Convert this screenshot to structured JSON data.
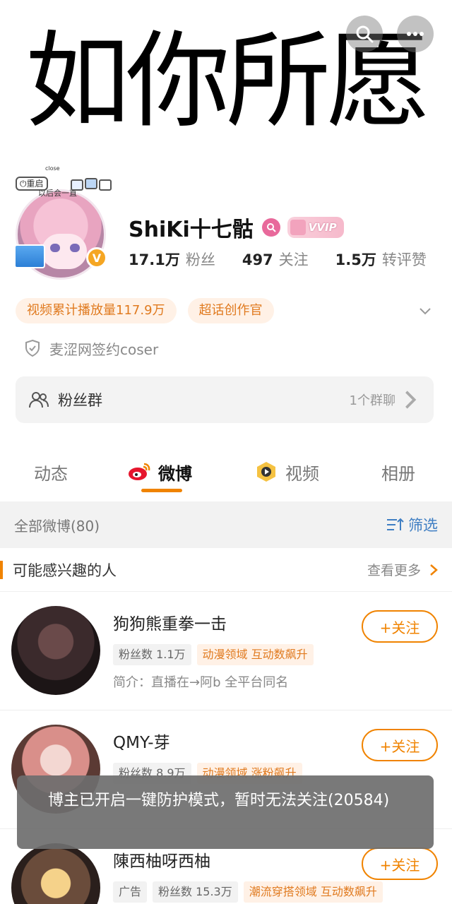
{
  "banner": {
    "text": "如你所愿",
    "back_icon": "back-arrow-icon",
    "search_icon": "search-icon",
    "more_icon": "more-icon"
  },
  "profile": {
    "avatar_labels": {
      "restart": "⏻重启",
      "close": "close",
      "later": "以后会一直"
    },
    "verified_badge": "V",
    "nickname": "ShiKi十七骷",
    "vvip_label": "VVIP",
    "stats": [
      {
        "num": "17.1万",
        "label": "粉丝"
      },
      {
        "num": "497",
        "label": "关注"
      },
      {
        "num": "1.5万",
        "label": "转评赞"
      }
    ],
    "tags": [
      "视频累计播放量117.9万",
      "超话创作官"
    ],
    "signed": "麦涩网签约coser",
    "fans_group": {
      "title": "粉丝群",
      "count": "1个群聊"
    }
  },
  "tabs": [
    {
      "label": "动态"
    },
    {
      "label": "微博"
    },
    {
      "label": "视频"
    },
    {
      "label": "相册"
    }
  ],
  "filter_bar": {
    "title": "全部微博(80)",
    "button": "筛选"
  },
  "interest": {
    "title": "可能感兴趣的人",
    "more": "查看更多",
    "people": [
      {
        "name": "狗狗熊重拳一击",
        "tags": [
          "粉丝数 1.1万",
          "动漫领域 互动数飙升"
        ],
        "intro": "简介：直播在→阿b 全平台同名",
        "follow": "+关注"
      },
      {
        "name": "QMY-芽",
        "tags": [
          "粉丝数 8.9万",
          "动漫领域 涨粉飙升"
        ],
        "intro": "",
        "follow": "+关注"
      },
      {
        "name": "陳西柚呀西柚",
        "tags": [
          "广告",
          "粉丝数 15.3万",
          "潮流穿搭领域 互动数飙升"
        ],
        "intro": "",
        "follow": "+关注"
      }
    ]
  },
  "toast": {
    "text": "博主已开启一键防护模式，暂时无法关注(20584)"
  },
  "colors": {
    "accent": "#f08300",
    "link": "#3f7ec3",
    "tag_bg": "#fff1e6",
    "tag_text": "#e07a1f"
  }
}
